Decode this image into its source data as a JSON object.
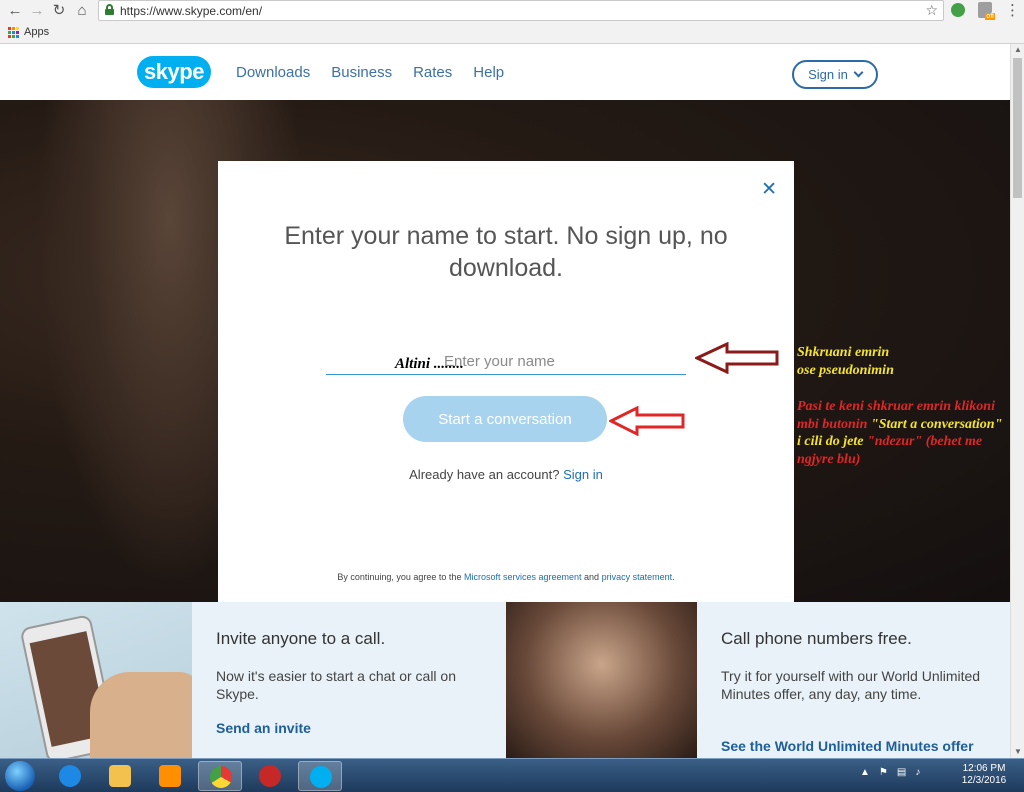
{
  "browser": {
    "url": "https://www.skype.com/en/",
    "bookmarks_apps": "Apps"
  },
  "site": {
    "logo": "skype",
    "nav": [
      "Downloads",
      "Business",
      "Rates",
      "Help"
    ],
    "signin": "Sign in"
  },
  "modal": {
    "title": "Enter your name to start. No sign up, no download.",
    "name_placeholder": "Enter your name",
    "typed_overlay": "Altini ........",
    "start_button": "Start a conversation",
    "already_text": "Already have an account?",
    "already_link": "Sign in",
    "legal_prefix": "By continuing, you agree to the",
    "legal_link1": "Microsoft services agreement",
    "legal_and": "and",
    "legal_link2": "privacy statement",
    "legal_suffix": "."
  },
  "annotations": {
    "note1_line1": "Shkruani emrin",
    "note1_line2": "ose pseudonimin",
    "note2_part1": "Pasi te keni shkruar emrin klikoni mbi butonin",
    "note2_quote1": "\"Start a conversation\"",
    "note2_part2": "i cili do jete",
    "note2_quote2": "\"ndezur\"",
    "note2_part3": "(behet me ngjyre blu)"
  },
  "features": [
    {
      "title": "Invite anyone to a call.",
      "body": "Now it's easier to start a chat or call on Skype.",
      "link": "Send an invite"
    },
    {
      "title": "Call phone numbers free.",
      "body": "Try it for yourself with our World Unlimited Minutes offer, any day, any time.",
      "link": "See the World Unlimited Minutes offer"
    }
  ],
  "taskbar": {
    "time": "12:06 PM",
    "date": "12/3/2016"
  },
  "colors": {
    "skype_blue": "#00aff0",
    "link_blue": "#1e6fb5",
    "button_disabled": "#a8d3ee",
    "arrow_dark_red": "#8b1a1a",
    "arrow_red": "#e02626",
    "note_yellow": "#f5e52a"
  }
}
